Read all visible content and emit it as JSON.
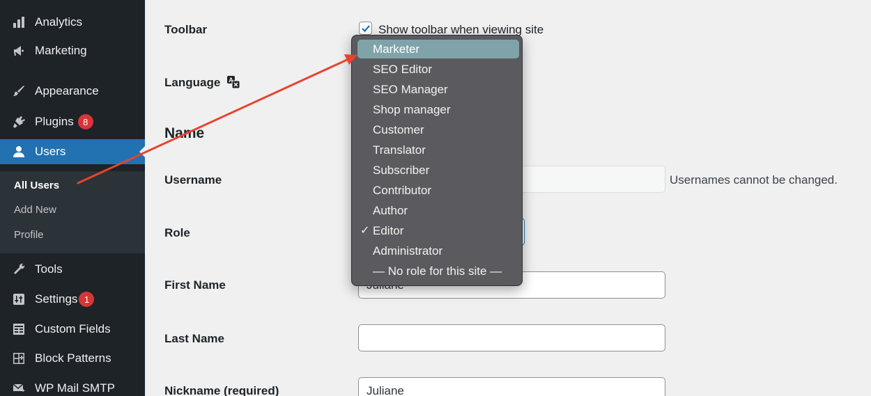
{
  "sidebar": {
    "items": [
      {
        "label": "Analytics",
        "icon": "bar-chart-icon"
      },
      {
        "label": "Marketing",
        "icon": "megaphone-icon"
      },
      {
        "label": "Appearance",
        "icon": "paintbrush-icon"
      },
      {
        "label": "Plugins",
        "icon": "plug-icon",
        "badge": "8"
      },
      {
        "label": "Users",
        "icon": "user-icon",
        "active": true
      },
      {
        "label": "Tools",
        "icon": "wrench-icon"
      },
      {
        "label": "Settings",
        "icon": "settings-icon",
        "badge": "1"
      },
      {
        "label": "Custom Fields",
        "icon": "fields-icon"
      },
      {
        "label": "Block Patterns",
        "icon": "block-patterns-icon"
      },
      {
        "label": "WP Mail SMTP",
        "icon": "mail-icon"
      }
    ],
    "submenu": [
      {
        "label": "All Users",
        "current": true
      },
      {
        "label": "Add New"
      },
      {
        "label": "Profile"
      }
    ]
  },
  "form": {
    "toolbar_label": "Toolbar",
    "toolbar_checkbox_label": "Show toolbar when viewing site",
    "toolbar_checked": true,
    "language_label": "Language",
    "name_heading": "Name",
    "username_label": "Username",
    "username_hint": "Usernames cannot be changed.",
    "role_label": "Role",
    "first_name_label": "First Name",
    "first_name_value": "Juliane",
    "last_name_label": "Last Name",
    "last_name_value": "",
    "nickname_label": "Nickname (required)",
    "nickname_value": "Juliane"
  },
  "role_dropdown": {
    "options": [
      "Marketer",
      "SEO Editor",
      "SEO Manager",
      "Shop manager",
      "Customer",
      "Translator",
      "Subscriber",
      "Contributor",
      "Author",
      "Editor",
      "Administrator",
      "— No role for this site —"
    ],
    "highlighted": "Marketer",
    "selected": "Editor",
    "check_mark": "✓"
  },
  "colors": {
    "sidebar_bg": "#1d2327",
    "active_blue": "#2271b1",
    "badge_red": "#d63638",
    "dropdown_bg": "#5b5a5e",
    "highlight": "#7fa3a8",
    "annotation_arrow": "#e8432e"
  }
}
